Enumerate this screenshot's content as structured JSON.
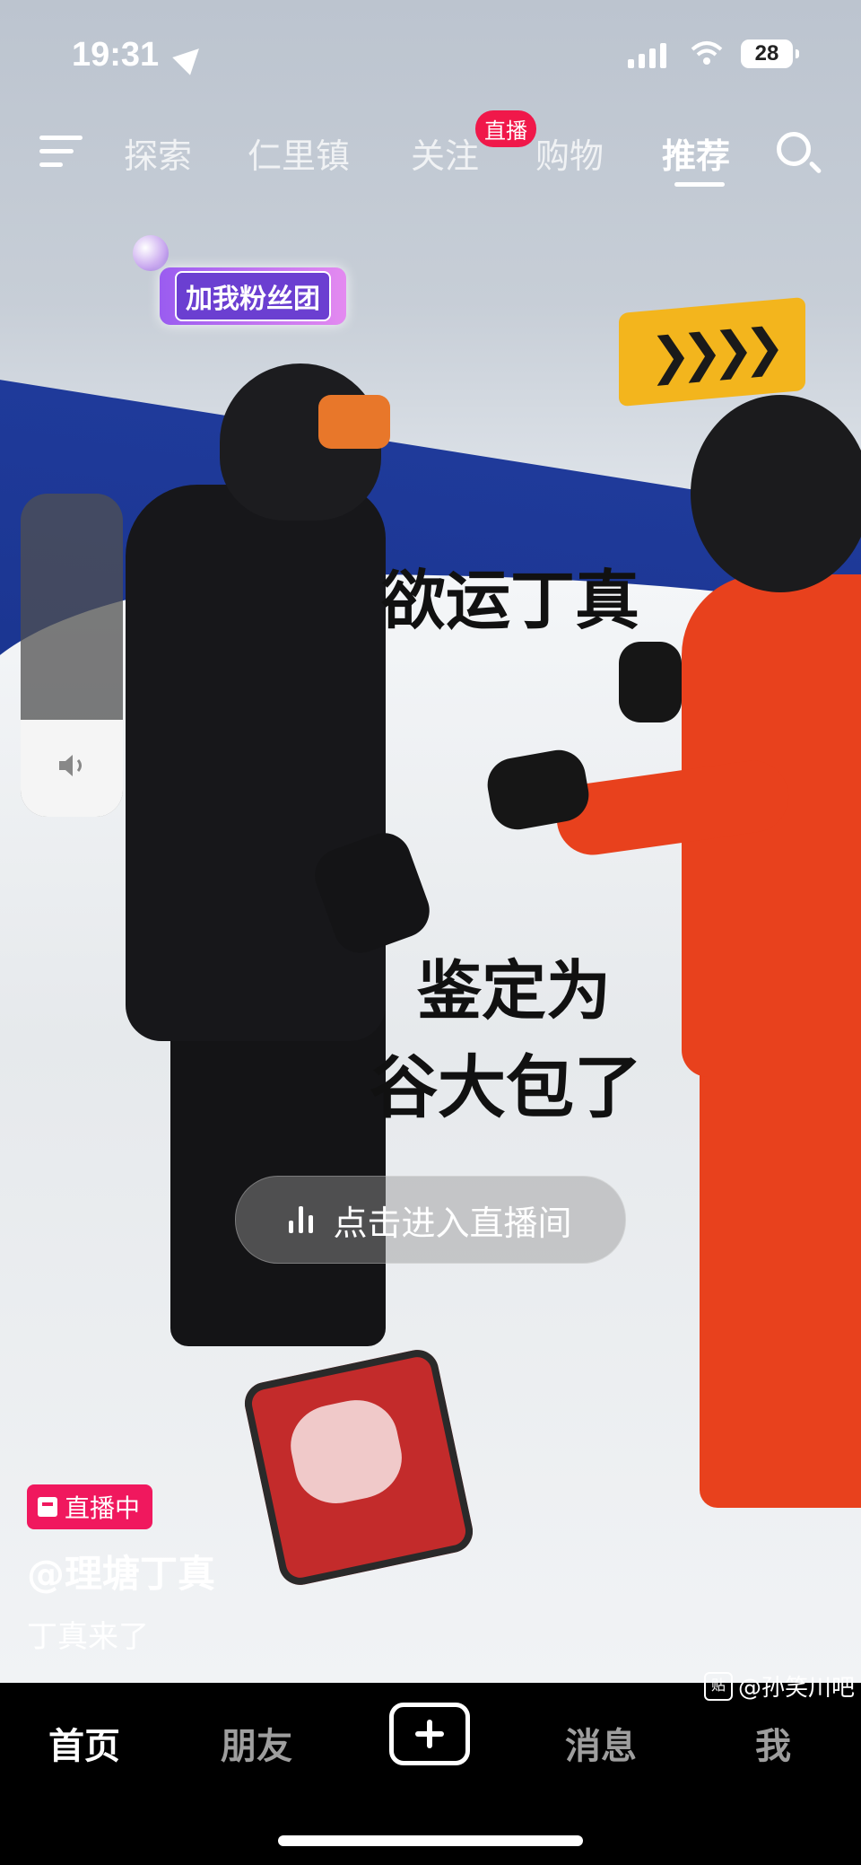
{
  "status_bar": {
    "time": "19:31",
    "battery": "28"
  },
  "top_nav": {
    "tabs": [
      "探索",
      "仁里镇",
      "关注",
      "购物",
      "推荐"
    ],
    "active_tab": "推荐",
    "live_badge": "直播"
  },
  "video": {
    "sticker": "加我粉丝团",
    "overlay_line1": "欲运丁真",
    "overlay_line2": "鉴定为",
    "overlay_line3": "谷大包了",
    "enter_live": "点击进入直播间",
    "volume_level": 0.3
  },
  "info": {
    "live_tag": "直播中",
    "username": "@理塘丁真",
    "caption": "丁真来了"
  },
  "bottom_nav": {
    "items": [
      "首页",
      "朋友",
      "消息",
      "我"
    ],
    "active": "首页"
  },
  "watermark": "@孙笑川吧"
}
